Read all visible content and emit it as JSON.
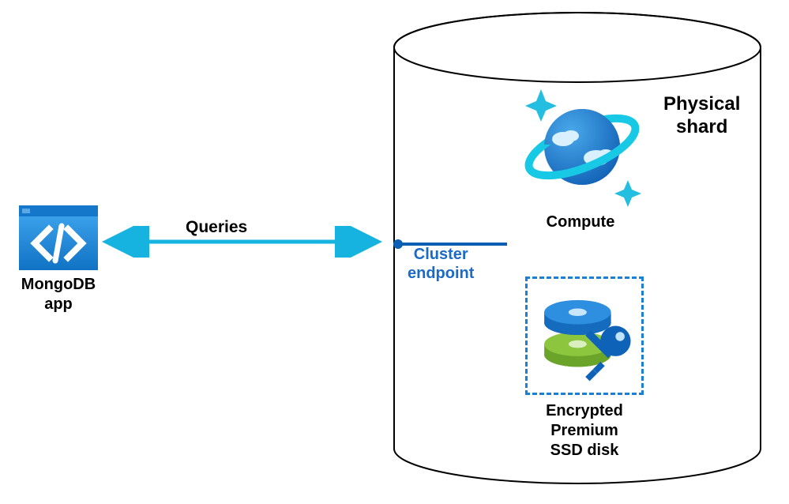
{
  "app": {
    "label_line1": "MongoDB",
    "label_line2": "app"
  },
  "connector": {
    "label": "Queries"
  },
  "cluster_endpoint": {
    "label_line1": "Cluster",
    "label_line2": "endpoint"
  },
  "shard": {
    "title_line1": "Physical",
    "title_line2": "shard",
    "compute_label": "Compute",
    "disk_label_line1": "Encrypted",
    "disk_label_line2": "Premium",
    "disk_label_line3": "SSD disk"
  },
  "colors": {
    "azure_blue": "#0f6fd1",
    "azure_light": "#29a7de",
    "green": "#7cb342",
    "cyan": "#18bfe0"
  }
}
